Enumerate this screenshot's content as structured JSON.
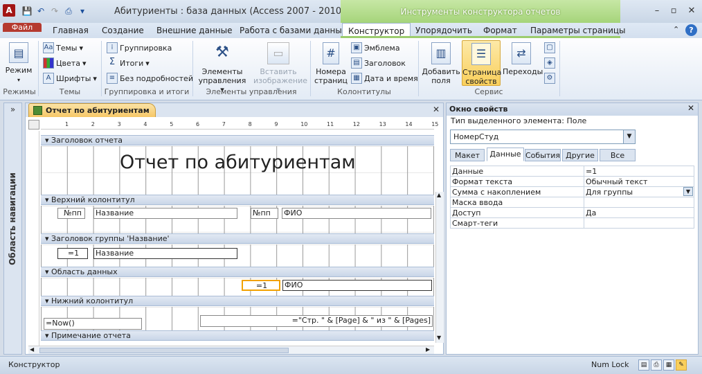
{
  "titlebar": {
    "title": "Абитуриенты : база данных (Access 2007 - 2010)  -  M",
    "context_tools": "Инструменты конструктора отчетов",
    "app_letter": "A"
  },
  "tabs": {
    "file": "Файл",
    "items": [
      "Главная",
      "Создание",
      "Внешние данные",
      "Работа с базами данных",
      "Конструктор",
      "Упорядочить",
      "Формат",
      "Параметры страницы"
    ]
  },
  "ribbon": {
    "groups": {
      "modes": "Режимы",
      "themes": "Темы",
      "grouping": "Группировка и итоги",
      "controls": "Элементы управления",
      "headers": "Колонтитулы",
      "service": "Сервис"
    },
    "mode_btn": "Режим",
    "themes_btn": "Темы",
    "colors_btn": "Цвета",
    "fonts_btn": "Шрифты",
    "grouping_btn": "Группировка",
    "totals_btn": "Итоги",
    "nodetails_btn": "Без подробностей",
    "elements_btn_1": "Элементы",
    "elements_btn_2": "управления",
    "insert_img_1": "Вставить",
    "insert_img_2": "изображение",
    "page_num_1": "Номера",
    "page_num_2": "страниц",
    "emblem_btn": "Эмблема",
    "header_btn": "Заголовок",
    "datetime_btn": "Дата и время",
    "add_fields_1": "Добавить",
    "add_fields_2": "поля",
    "props_page_1": "Страница",
    "props_page_2": "свойств",
    "transitions_btn": "Переходы"
  },
  "nav": {
    "label": "Область навигации",
    "toggle": "»"
  },
  "doc": {
    "tab_title": "Отчет по абитуриентам",
    "bands": [
      "Заголовок отчета",
      "Верхний колонтитул",
      "Заголовок группы 'Название'",
      "Область данных",
      "Нижний колонтитул",
      "Примечание отчета"
    ],
    "report_title": "Отчет по абитуриентам",
    "hdr_npp": "№пп",
    "hdr_name": "Название",
    "hdr_npp2": "№пп",
    "hdr_fio": "ФИО",
    "grp_eq1": "=1",
    "grp_name": "Название",
    "data_eq1": "=1",
    "data_fio": "ФИО",
    "footer_now": "=Now()",
    "footer_pages": "=\"Стр. \" & [Page] & \" из \" & [Pages]",
    "ruler": [
      "1",
      "2",
      "3",
      "4",
      "5",
      "6",
      "7",
      "8",
      "9",
      "10",
      "11",
      "12",
      "13",
      "14",
      "15"
    ]
  },
  "props": {
    "title": "Окно свойств",
    "sel_type": "Тип выделенного элемента:  Поле",
    "selected": "НомерСтуд",
    "tabs": [
      "Макет",
      "Данные",
      "События",
      "Другие",
      "Все"
    ],
    "active_tab": "Данные",
    "rows": [
      {
        "name": "Данные",
        "value": "=1"
      },
      {
        "name": "Формат текста",
        "value": "Обычный текст"
      },
      {
        "name": "Сумма с накоплением",
        "value": "Для группы"
      },
      {
        "name": "Маска ввода",
        "value": ""
      },
      {
        "name": "Доступ",
        "value": "Да"
      },
      {
        "name": "Смарт-теги",
        "value": ""
      }
    ]
  },
  "status": {
    "left": "Конструктор",
    "numlock": "Num Lock"
  }
}
